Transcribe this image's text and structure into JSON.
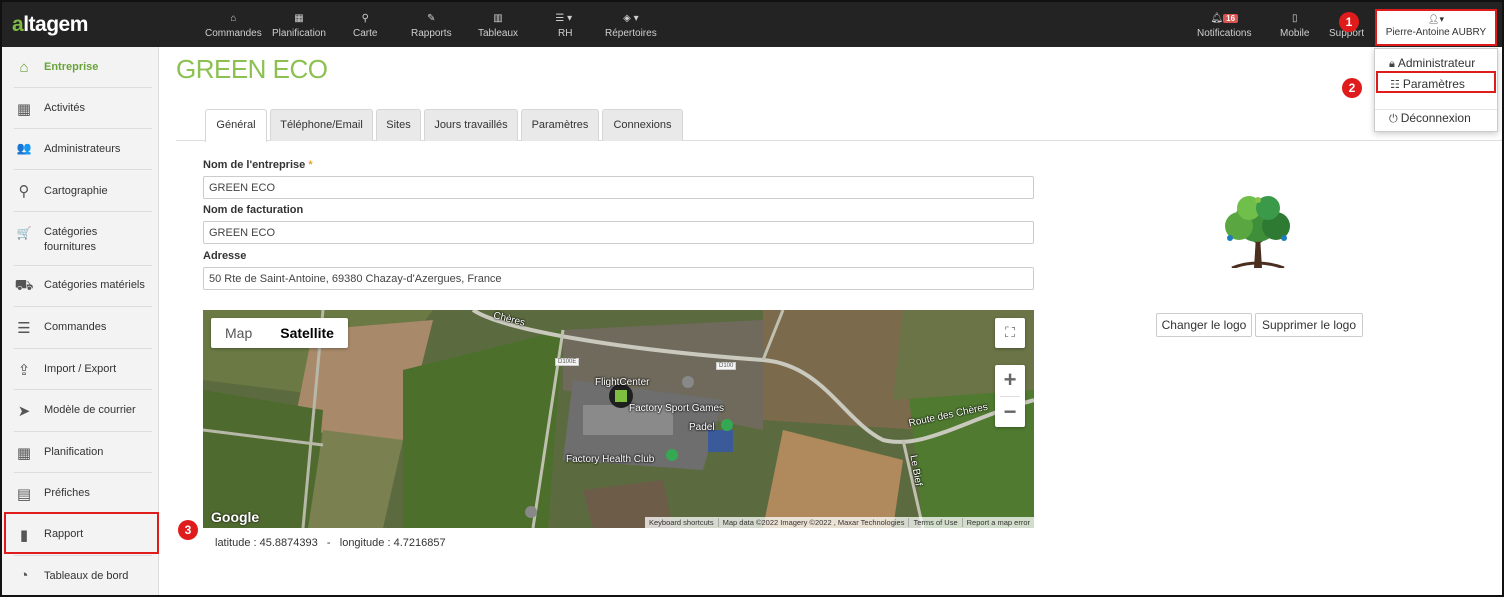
{
  "app": {
    "logo_text_a": "a",
    "logo_text_rest": "ltagem"
  },
  "topnav": {
    "items": [
      {
        "label": "Commandes",
        "icon": "inbox-icon",
        "glyph": "⌂"
      },
      {
        "label": "Planification",
        "icon": "calendar-icon",
        "glyph": "▦"
      },
      {
        "label": "Carte",
        "icon": "map-marker-icon",
        "glyph": "⚲"
      },
      {
        "label": "Rapports",
        "icon": "edit-icon",
        "glyph": "✎"
      },
      {
        "label": "Tableaux",
        "icon": "table-icon",
        "glyph": "▥"
      },
      {
        "label": "RH",
        "icon": "list-icon",
        "glyph": "☰ ▾"
      },
      {
        "label": "Répertoires",
        "icon": "cube-icon",
        "glyph": "◈ ▾"
      }
    ],
    "notifications_label": "Notifications",
    "notifications_count": "16",
    "mobile_label": "Mobile",
    "support_label": "Support",
    "user_name": "Pierre-Antoine AUBRY"
  },
  "callouts": [
    "1",
    "2",
    "3"
  ],
  "user_menu": {
    "administrateur": "Administrateur",
    "parametres": "Paramètres",
    "deconnexion": "Déconnexion"
  },
  "sidebar": {
    "items": [
      {
        "label": "Entreprise",
        "icon": "home-icon",
        "glyph": "⌂",
        "active": true
      },
      {
        "label": "Activités",
        "icon": "grid-icon",
        "glyph": "▦"
      },
      {
        "label": "Administrateurs",
        "icon": "users-icon",
        "glyph": "👥"
      },
      {
        "label": "Cartographie",
        "icon": "map-marker-icon",
        "glyph": "⚲"
      },
      {
        "label": "Catégories fournitures",
        "icon": "cart-icon",
        "glyph": "🛒"
      },
      {
        "label": "Catégories matériels",
        "icon": "truck-icon",
        "glyph": "⛟"
      },
      {
        "label": "Commandes",
        "icon": "list-icon",
        "glyph": "☰"
      },
      {
        "label": "Import / Export",
        "icon": "upload-icon",
        "glyph": "⇪"
      },
      {
        "label": "Modèle de courrier",
        "icon": "paper-plane-icon",
        "glyph": "➤"
      },
      {
        "label": "Planification",
        "icon": "calendar-icon",
        "glyph": "▦"
      },
      {
        "label": "Préfiches",
        "icon": "form-icon",
        "glyph": "▤"
      },
      {
        "label": "Rapport",
        "icon": "file-icon",
        "glyph": "▮"
      },
      {
        "label": "Tableaux de bord",
        "icon": "dashboard-icon",
        "glyph": "◔"
      }
    ]
  },
  "page": {
    "title": "GREEN ECO",
    "tabs": [
      "Général",
      "Téléphone/Email",
      "Sites",
      "Jours travaillés",
      "Paramètres",
      "Connexions"
    ],
    "fields": {
      "company_label": "Nom de l'entreprise",
      "required_mark": "*",
      "company_value": "GREEN ECO",
      "billing_label": "Nom de facturation",
      "billing_value": "GREEN ECO",
      "address_label": "Adresse",
      "address_value": "50 Rte de Saint-Antoine, 69380 Chazay-d'Azergues, France"
    },
    "logo_buttons": {
      "change": "Changer le logo",
      "delete": "Supprimer le logo"
    },
    "coordinates": "latitude : 45.8874393   -   longitude : 4.7216857"
  },
  "map": {
    "type_map": "Map",
    "type_satellite": "Satellite",
    "selected_type": "Satellite",
    "google": "Google",
    "labels": {
      "flight_center": "FlightCenter",
      "sport_games": "Factory Sport Games",
      "padel": "Padel",
      "health_club": "Factory Health Club",
      "route": "Route des Chères",
      "bief": "Le Bief",
      "cheres": "Chères",
      "d100e": "D100E",
      "d100": "D100"
    },
    "attribution": [
      "Keyboard shortcuts",
      "Map data ©2022 Imagery ©2022 , Maxar Technologies",
      "Terms of Use",
      "Report a map error"
    ]
  },
  "colors": {
    "accent_green": "#8cc152",
    "topbar": "#232323",
    "highlight_red": "#e01b1b"
  }
}
